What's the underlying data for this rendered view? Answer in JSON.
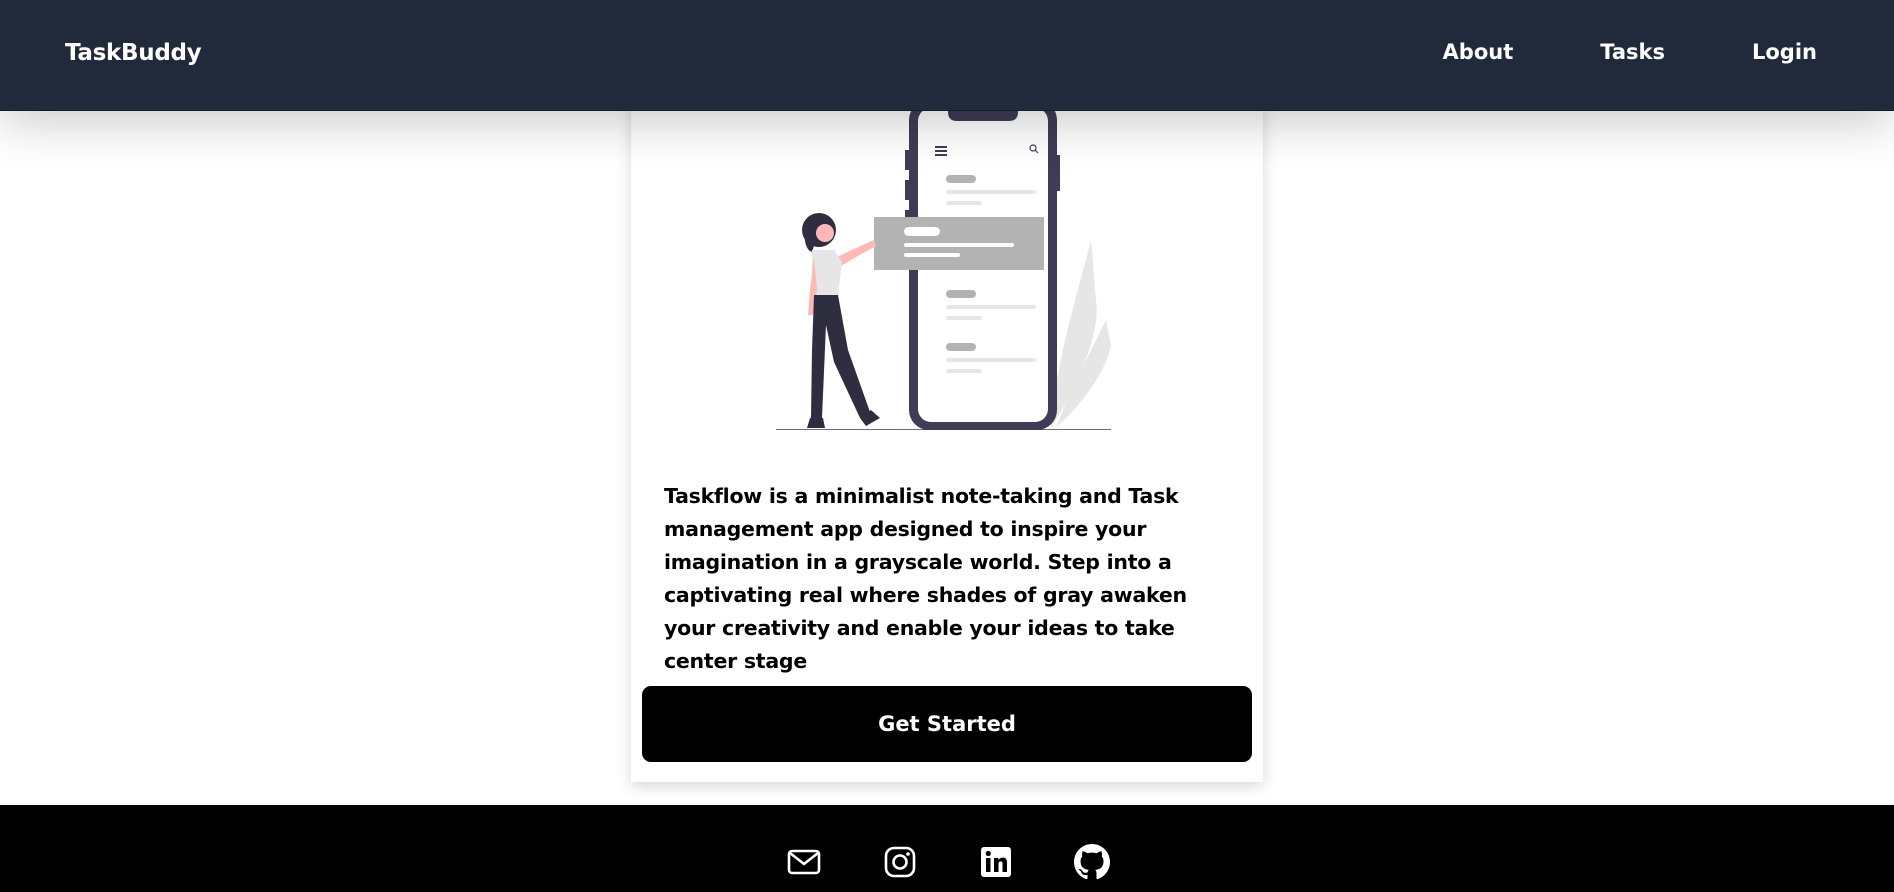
{
  "navbar": {
    "brand": "TaskBuddy",
    "links": [
      {
        "label": "About"
      },
      {
        "label": "Tasks"
      },
      {
        "label": "Login"
      }
    ]
  },
  "hero": {
    "illustration": "person-with-phone-task-list",
    "description": "Taskflow is a minimalist note-taking and Task management app designed to inspire your imagination in a grayscale world. Step into a captivating real where shades of gray awaken your creativity and enable your ideas to take center stage",
    "cta_label": "Get Started"
  },
  "footer": {
    "icons": [
      "mail-icon",
      "instagram-icon",
      "linkedin-icon",
      "github-icon"
    ]
  },
  "colors": {
    "navbar_bg": "#212a3b",
    "footer_bg": "#000000",
    "button_bg": "#000000",
    "text": "#000000"
  }
}
